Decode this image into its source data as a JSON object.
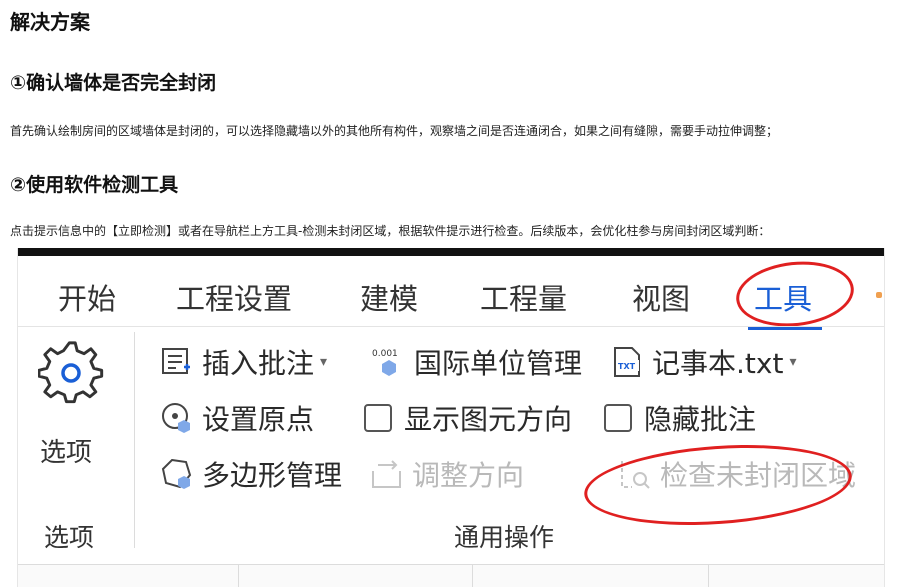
{
  "article": {
    "heading": "解决方案",
    "step1_title": "①确认墙体是否完全封闭",
    "step1_text": "首先确认绘制房间的区域墙体是封闭的，可以选择隐藏墙以外的其他所有构件，观察墙之间是否连通闭合，如果之间有缝隙，需要手动拉伸调整；",
    "step2_title": "②使用软件检测工具",
    "step2_text": "点击提示信息中的【立即检测】或者在导航栏上方工具-检测未封闭区域，根据软件提示进行检查。后续版本，会优化柱参与房间封闭区域判断："
  },
  "ribbon": {
    "tabs": [
      "开始",
      "工程设置",
      "建模",
      "工程量",
      "视图",
      "工具"
    ],
    "active_tab": "工具",
    "options_button": {
      "label": "选项",
      "icon": "gear-icon"
    },
    "options_group_label": "选项",
    "common_group_label": "通用操作",
    "commands": {
      "insert_comment": "插入批注",
      "intl_units": "国际单位管理",
      "notepad": "记事本.txt",
      "set_origin": "设置原点",
      "show_direction": "显示图元方向",
      "hide_comment": "隐藏批注",
      "polygon_mgmt": "多边形管理",
      "adjust_direction": "调整方向",
      "check_unclosed": "检查未封闭区域"
    },
    "unit_icon_text": "0.001",
    "txt_icon_text": "TXT",
    "colors": {
      "accent": "#1a5fd6",
      "annotation": "#e02020",
      "disabled": "#b9b9b9"
    }
  }
}
